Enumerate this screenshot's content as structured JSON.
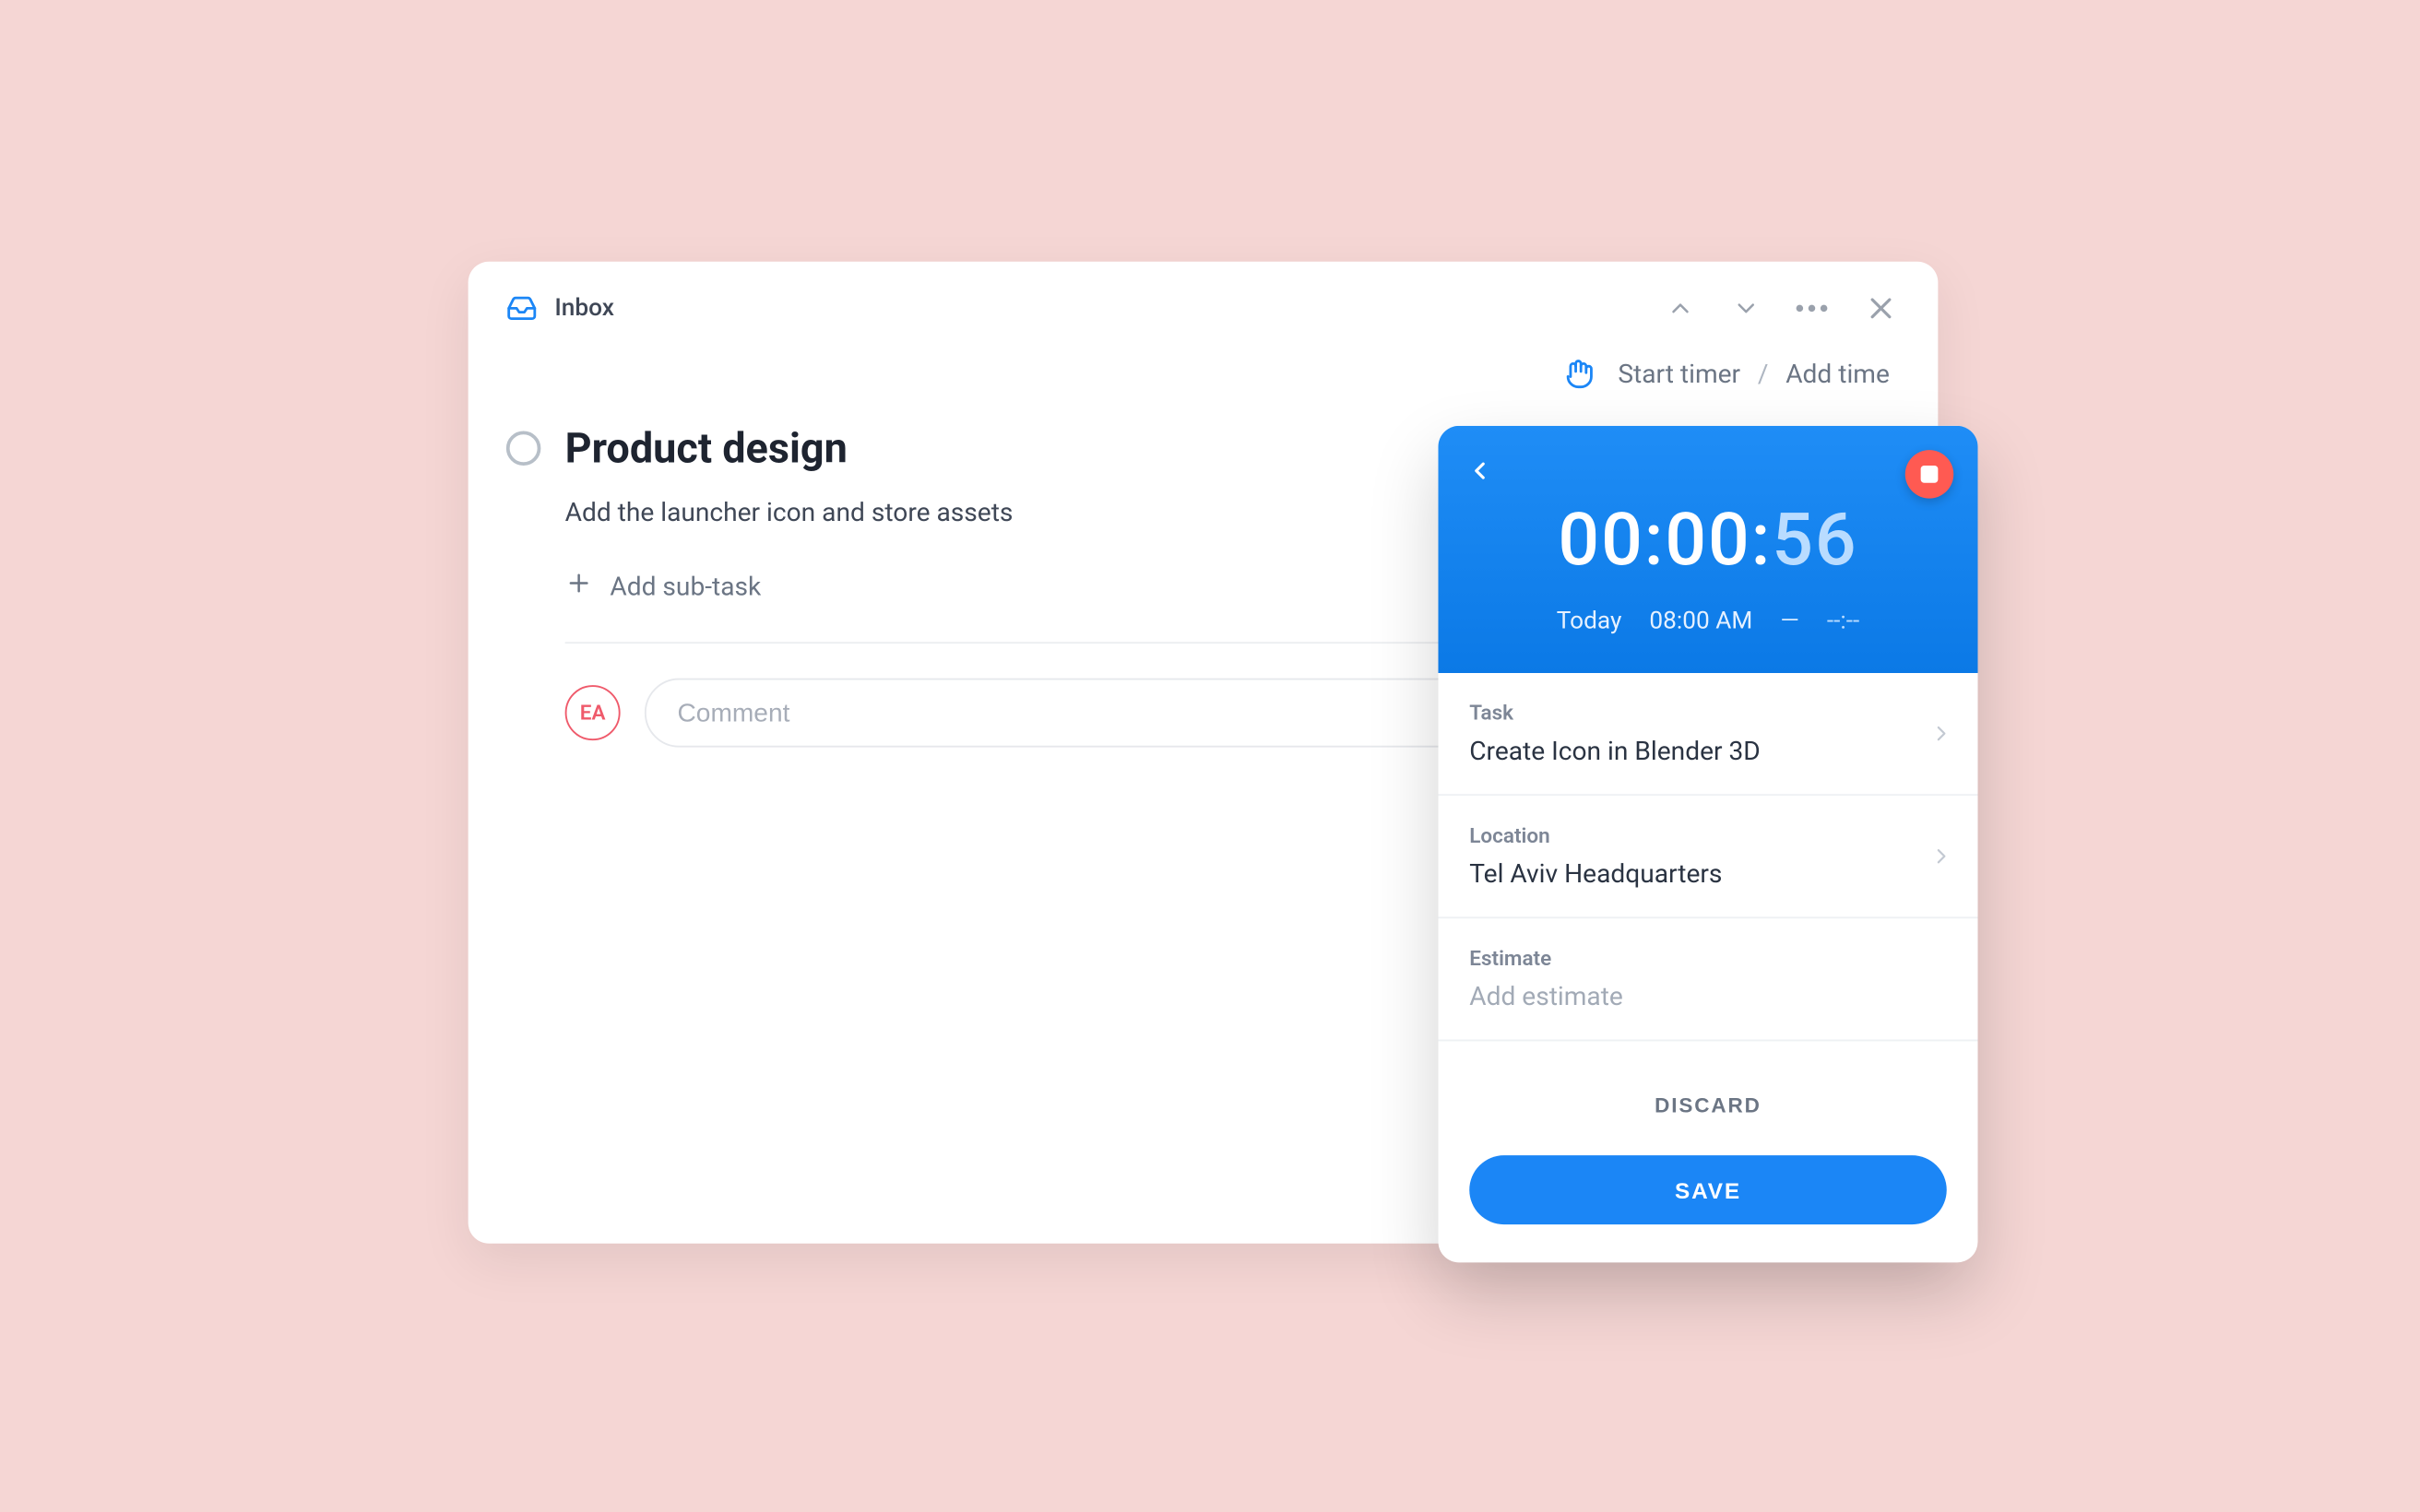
{
  "header": {
    "inbox_label": "Inbox"
  },
  "actions": {
    "start_timer": "Start timer",
    "separator": "/",
    "add_time": "Add time"
  },
  "task": {
    "title": "Product design",
    "description": "Add the launcher icon and store assets",
    "add_subtask": "Add sub-task"
  },
  "comment": {
    "avatar_initials": "EA",
    "placeholder": "Comment"
  },
  "timer": {
    "clock_main": "00:00:",
    "clock_seconds": "56",
    "day_label": "Today",
    "start_time": "08:00 AM",
    "dash": "—",
    "end_time": "--:--",
    "sections": {
      "task_label": "Task",
      "task_value": "Create Icon in Blender 3D",
      "location_label": "Location",
      "location_value": "Tel Aviv Headquarters",
      "estimate_label": "Estimate",
      "estimate_placeholder": "Add estimate"
    },
    "discard": "DISCARD",
    "save": "SAVE"
  }
}
